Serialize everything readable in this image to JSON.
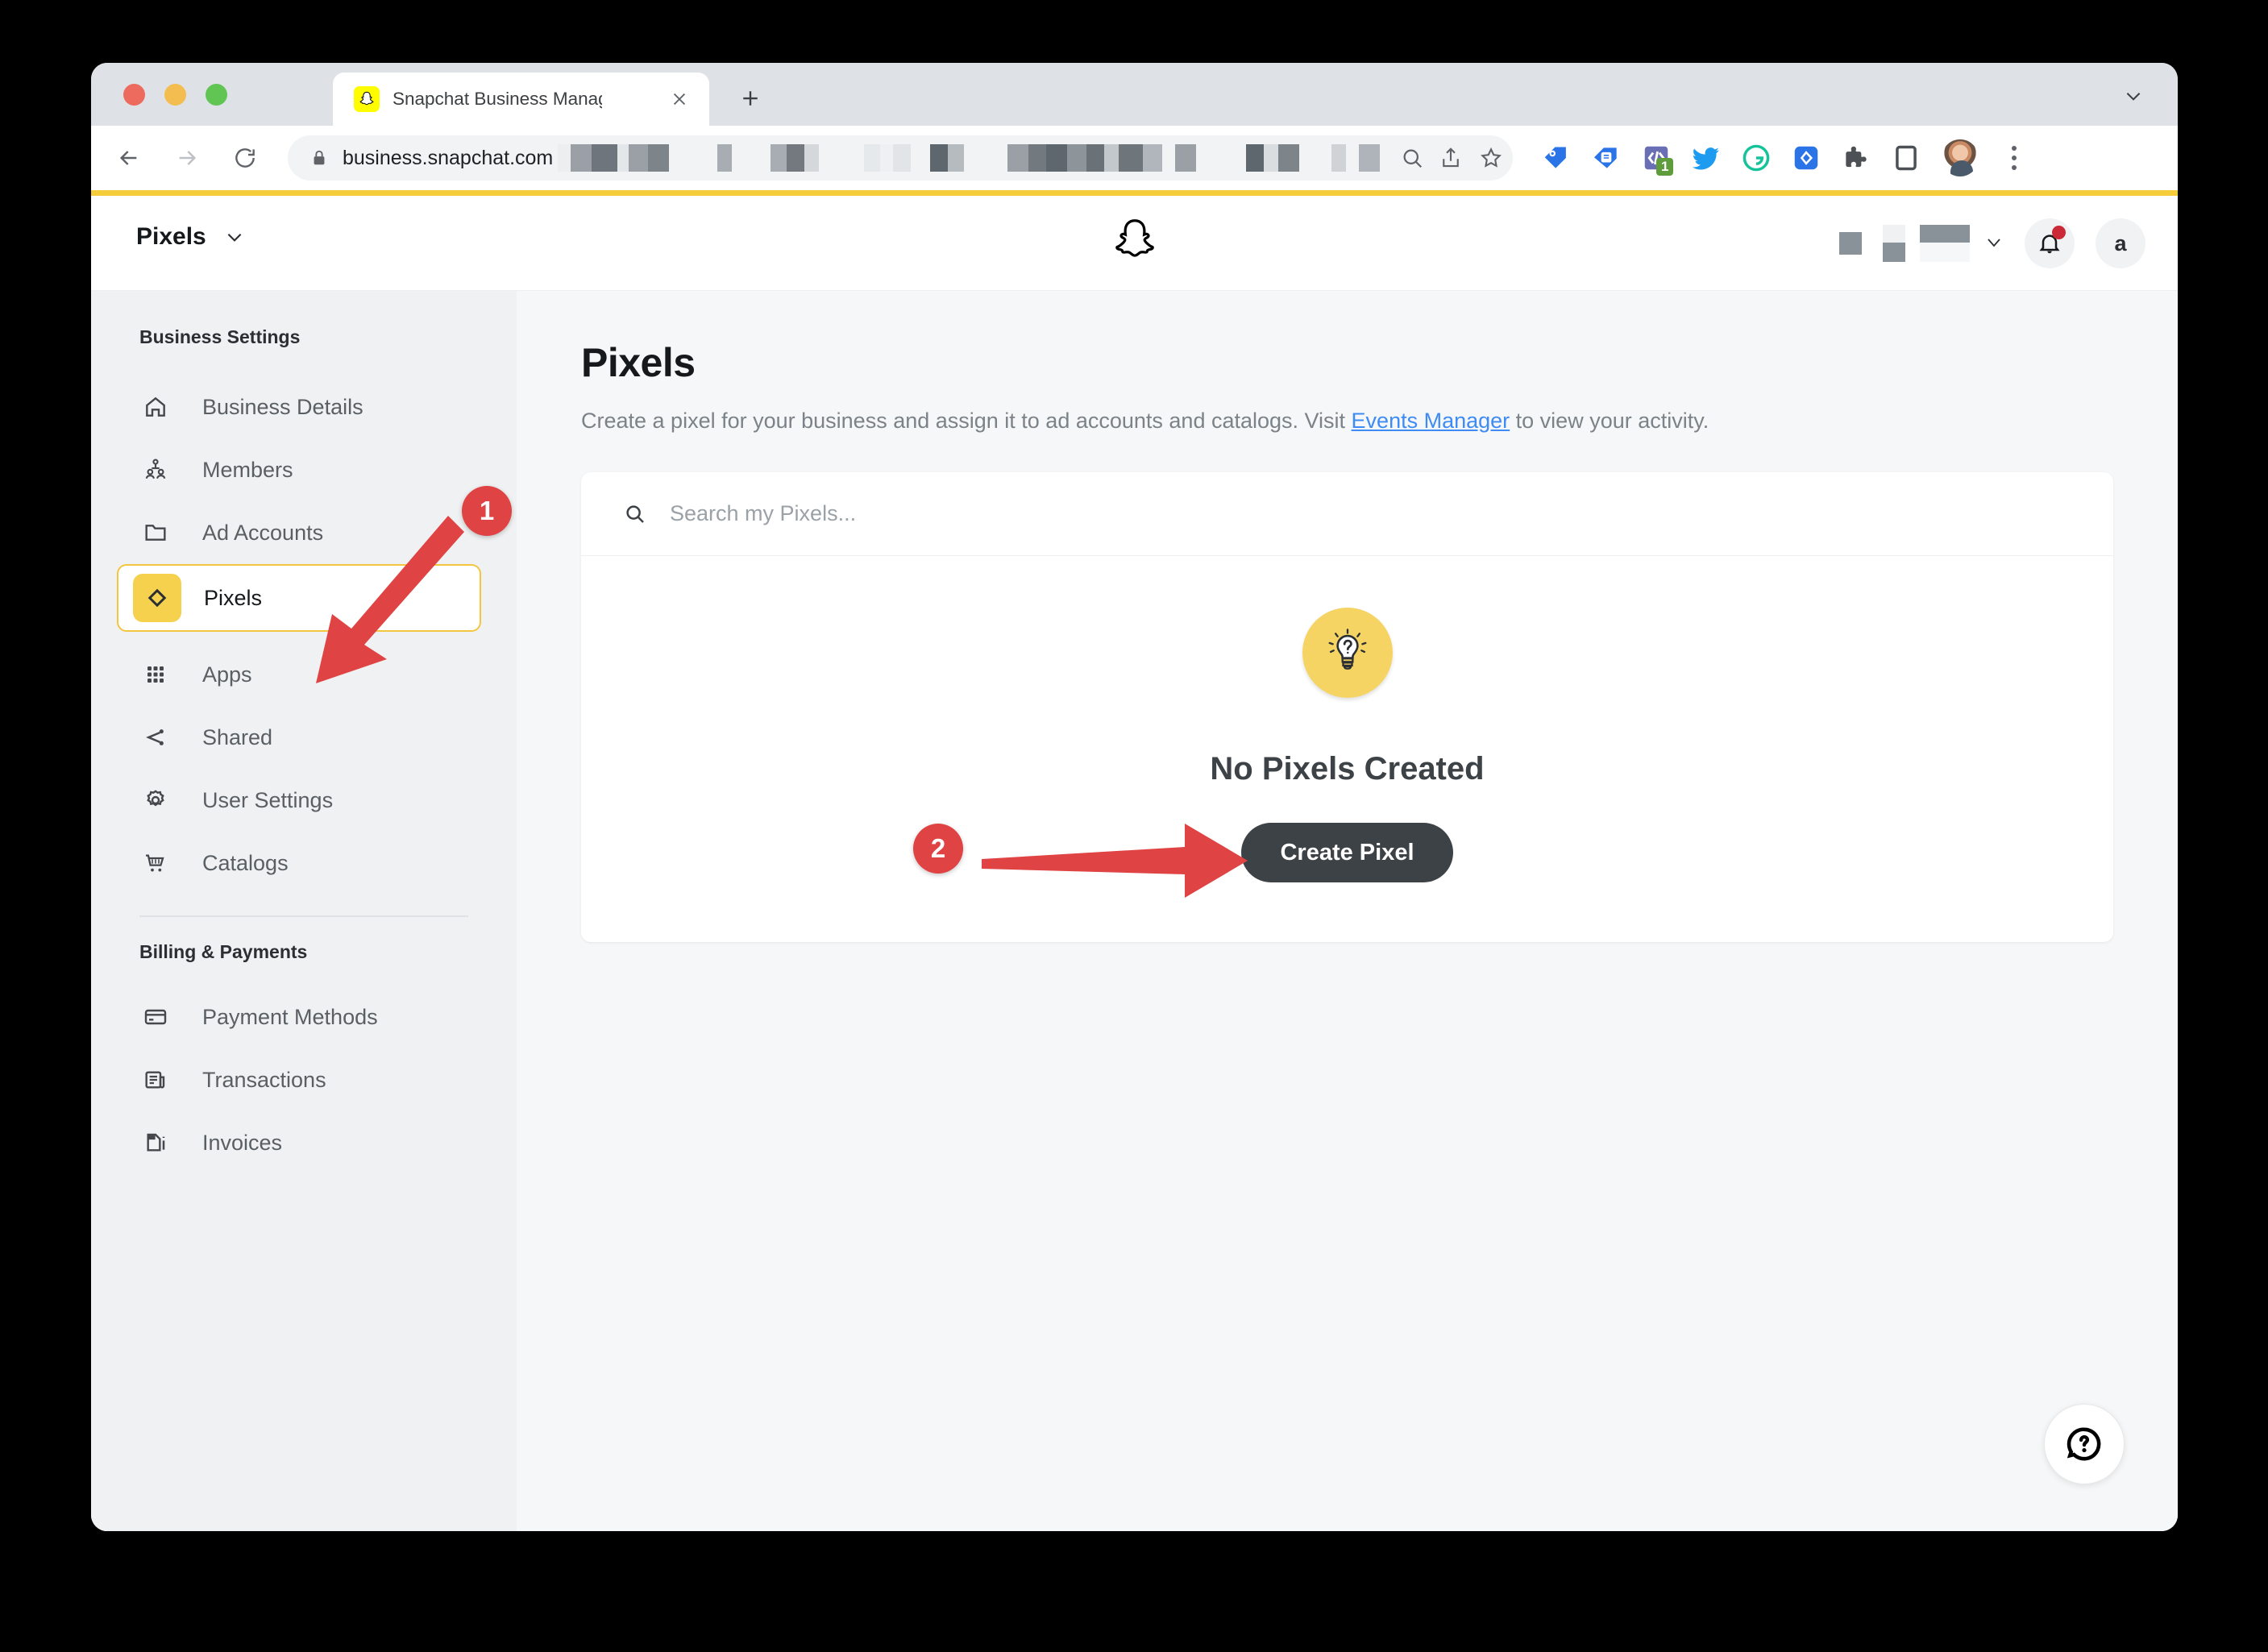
{
  "browser": {
    "tab": {
      "title": "Snapchat Business Manager",
      "favicon": "snapchat-ghost-icon"
    },
    "new_tab_label": "+",
    "close_label": "✕",
    "omnibox": {
      "url_visible": "business.snapchat.com",
      "url_redacted": true,
      "lock_icon": "lock-icon"
    },
    "extensions": [
      {
        "name": "tag-icon-blue"
      },
      {
        "name": "card-icon-blue"
      },
      {
        "name": "code-icon-purple",
        "badge": "1"
      },
      {
        "name": "twitter-bird-icon"
      },
      {
        "name": "grammarly-icon"
      },
      {
        "name": "tag-icon-solid-blue"
      },
      {
        "name": "puzzle-piece-icon"
      },
      {
        "name": "sidepanel-icon"
      }
    ]
  },
  "app_header": {
    "title": "Pixels",
    "logo": "snapchat-ghost-logo",
    "notifications_badge": true,
    "avatar_letter": "a"
  },
  "sidebar": {
    "sections": [
      {
        "title": "Business Settings",
        "items": [
          {
            "label": "Business Details",
            "icon": "home-icon",
            "active": false
          },
          {
            "label": "Members",
            "icon": "members-icon",
            "active": false
          },
          {
            "label": "Ad Accounts",
            "icon": "folder-icon",
            "active": false
          },
          {
            "label": "Pixels",
            "icon": "pixel-diamond-icon",
            "active": true
          },
          {
            "label": "Apps",
            "icon": "grid-icon",
            "active": false
          },
          {
            "label": "Shared",
            "icon": "share-icon",
            "active": false
          },
          {
            "label": "User Settings",
            "icon": "gear-icon",
            "active": false
          },
          {
            "label": "Catalogs",
            "icon": "cart-icon",
            "active": false
          }
        ]
      },
      {
        "title": "Billing & Payments",
        "items": [
          {
            "label": "Payment Methods",
            "icon": "credit-card-icon",
            "active": false
          },
          {
            "label": "Transactions",
            "icon": "receipt-icon",
            "active": false
          },
          {
            "label": "Invoices",
            "icon": "invoice-icon",
            "active": false
          }
        ]
      }
    ]
  },
  "main": {
    "title": "Pixels",
    "subtitle_before": "Create a pixel for your business and assign it to ad accounts and catalogs. Visit ",
    "subtitle_link": "Events Manager",
    "subtitle_after": " to view your activity.",
    "search_placeholder": "Search my Pixels...",
    "search_value": "",
    "empty_state": {
      "icon": "lightbulb-question-icon",
      "title": "No Pixels Created",
      "button_label": "Create Pixel"
    },
    "help_button": "help-question-icon"
  },
  "annotations": {
    "steps": [
      {
        "number": "1",
        "target": "sidebar-item-pixels"
      },
      {
        "number": "2",
        "target": "create-pixel-button"
      }
    ]
  },
  "colors": {
    "snap_yellow": "#f5d14e",
    "loading_bar": "#f5cc3a",
    "annotation_red": "#df4343",
    "link_blue": "#3e8bf5",
    "button_dark": "#3d4246",
    "sidebar_bg": "#eff1f2",
    "page_bg": "#f6f7f8"
  }
}
